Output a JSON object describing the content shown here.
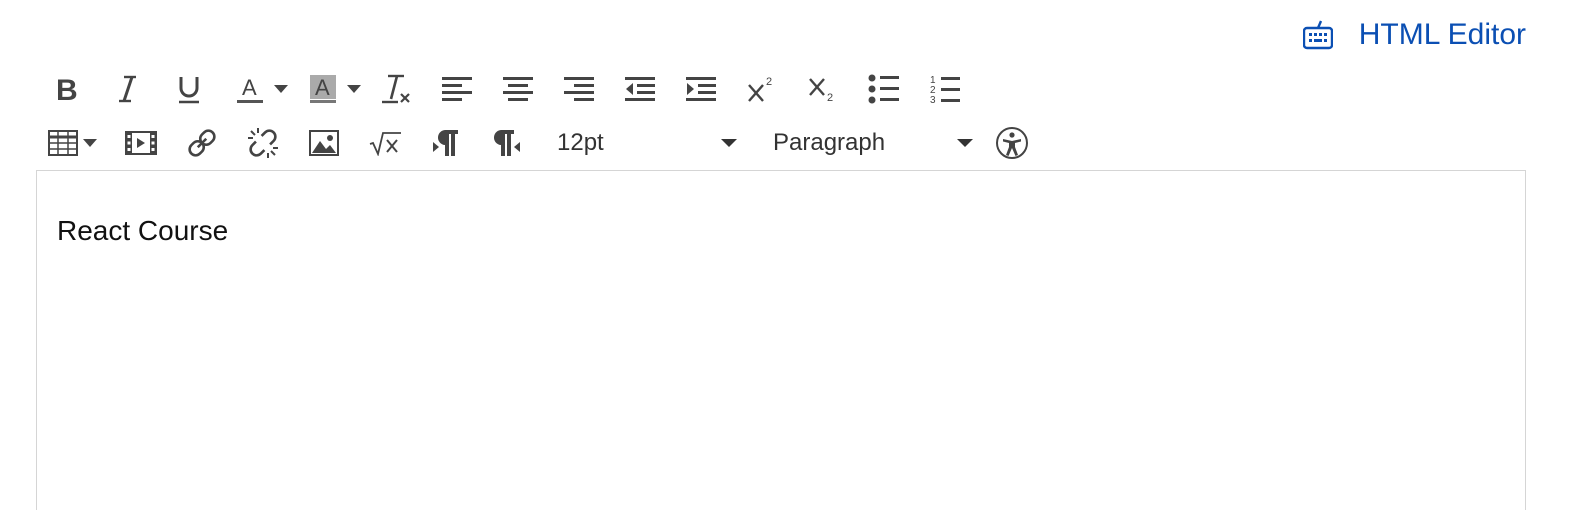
{
  "header": {
    "html_editor_label": "HTML Editor"
  },
  "toolbar": {
    "font_size": "12pt",
    "block_format": "Paragraph"
  },
  "editor": {
    "content": "React Course"
  },
  "icons": {
    "row1": [
      "bold-icon",
      "italic-icon",
      "underline-icon",
      "text-color-icon",
      "background-color-icon",
      "clear-formatting-icon",
      "align-left-icon",
      "align-center-icon",
      "align-right-icon",
      "outdent-icon",
      "indent-icon",
      "superscript-icon",
      "subscript-icon",
      "bullet-list-icon",
      "numbered-list-icon"
    ],
    "row2": [
      "table-icon",
      "media-icon",
      "link-icon",
      "unlink-icon",
      "image-icon",
      "equation-icon",
      "ltr-icon",
      "rtl-icon",
      "accessibility-icon",
      "keyboard-icon"
    ]
  },
  "colors": {
    "link": "#0b4fb3",
    "icon": "#444444",
    "editor_border": "#d5d5d5"
  }
}
